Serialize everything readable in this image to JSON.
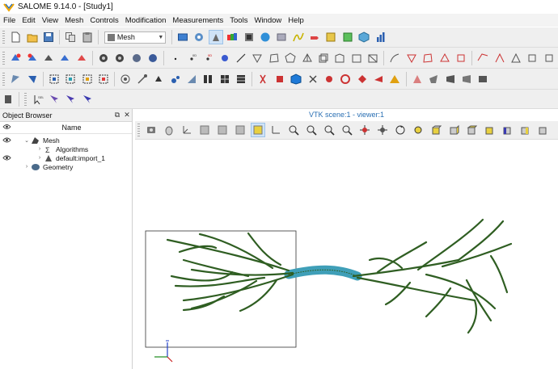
{
  "titlebar": {
    "title": "SALOME 9.14.0 - [Study1]"
  },
  "menubar": {
    "items": [
      "File",
      "Edit",
      "View",
      "Mesh",
      "Controls",
      "Modification",
      "Measurements",
      "Tools",
      "Window",
      "Help"
    ]
  },
  "toolbar1": {
    "module_combo": "Mesh",
    "icons": [
      "new-icon",
      "open-icon",
      "save-icon",
      "copy-icon",
      "paste-icon",
      "dump-icon",
      "mesh-module-icon",
      "select-icon",
      "mesh-view-icon",
      "shading-icon",
      "color-icon",
      "geometry-icon",
      "filter-icon",
      "curve-icon",
      "pointer-icon",
      "table-icon",
      "export-icon",
      "cube-icon",
      "bar-chart-icon"
    ]
  },
  "object_browser": {
    "title": "Object Browser",
    "column_name": "Name",
    "tree": [
      {
        "label": "Mesh",
        "level": 1,
        "expanded": true,
        "visible_eye": true
      },
      {
        "label": "Algorithms",
        "level": 2,
        "expanded": false,
        "visible_eye": false
      },
      {
        "label": "default:import_1",
        "level": 2,
        "expanded": false,
        "visible_eye": true
      },
      {
        "label": "Geometry",
        "level": 1,
        "expanded": false,
        "visible_eye": false
      }
    ]
  },
  "viewer": {
    "title": "VTK scene:1 - viewer:1"
  },
  "colors": {
    "accent": "#2a6fb3",
    "mesh_dark": "#2f5e22",
    "mesh_light": "#4a9fb5",
    "active_bg": "#cfe3f7"
  }
}
